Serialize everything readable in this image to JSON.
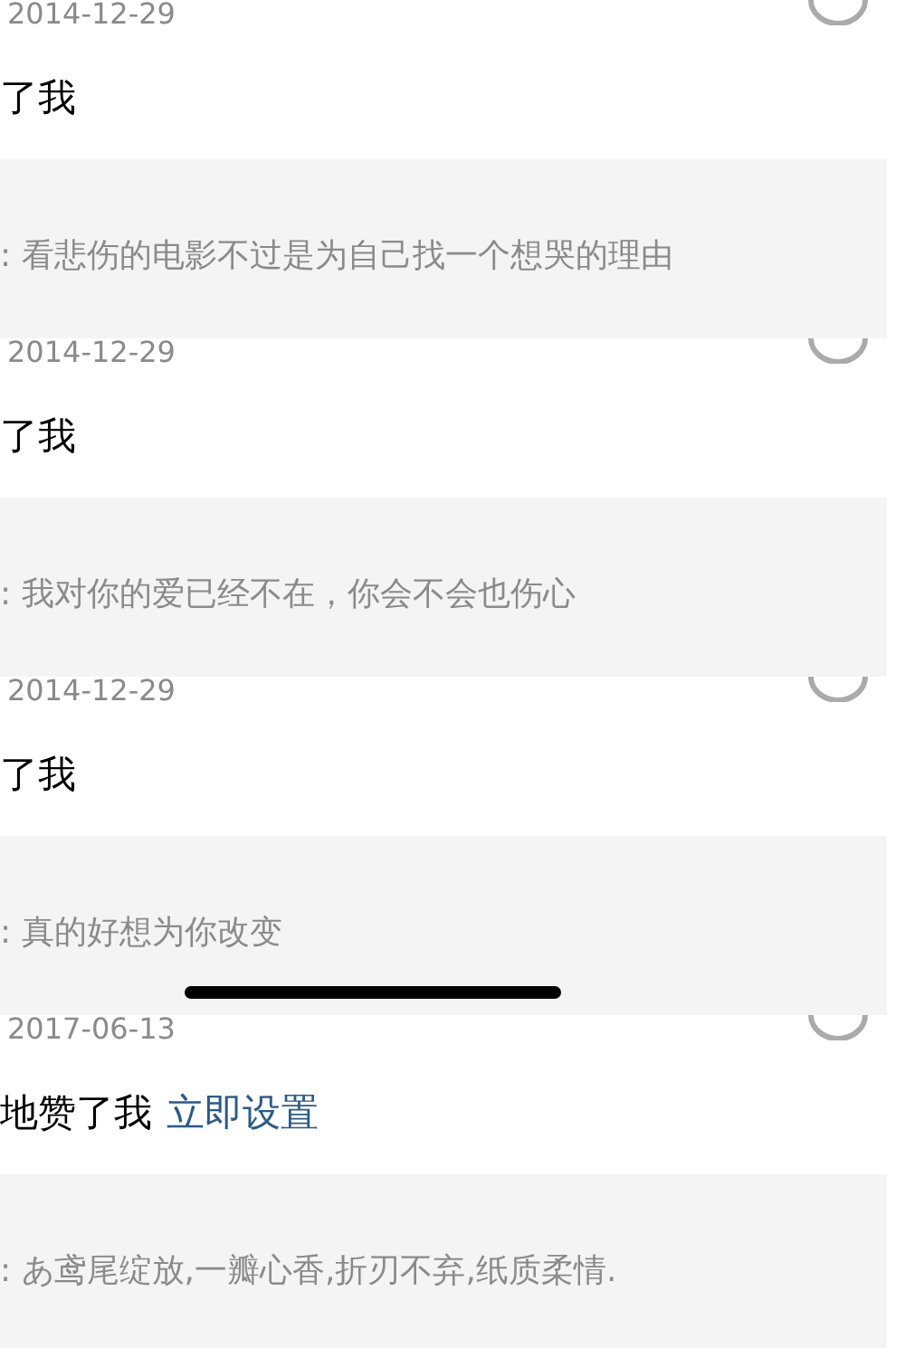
{
  "notifications": [
    {
      "date": "2014-12-29",
      "message": "了我",
      "quote": ": 看悲伤的电影不过是为自己找一个想哭的理由"
    },
    {
      "date": "2014-12-29",
      "message": "了我",
      "quote": ": 我对你的爱已经不在，你会不会也伤心"
    },
    {
      "date": "2014-12-29",
      "message": "了我",
      "quote": ": 真的好想为你改变"
    },
    {
      "date": "2017-06-13",
      "message": "地赞了我",
      "link": "立即设置",
      "quote": ": あ鸢尾绽放,一瓣心香,折刃不弃,纸质柔情."
    }
  ]
}
